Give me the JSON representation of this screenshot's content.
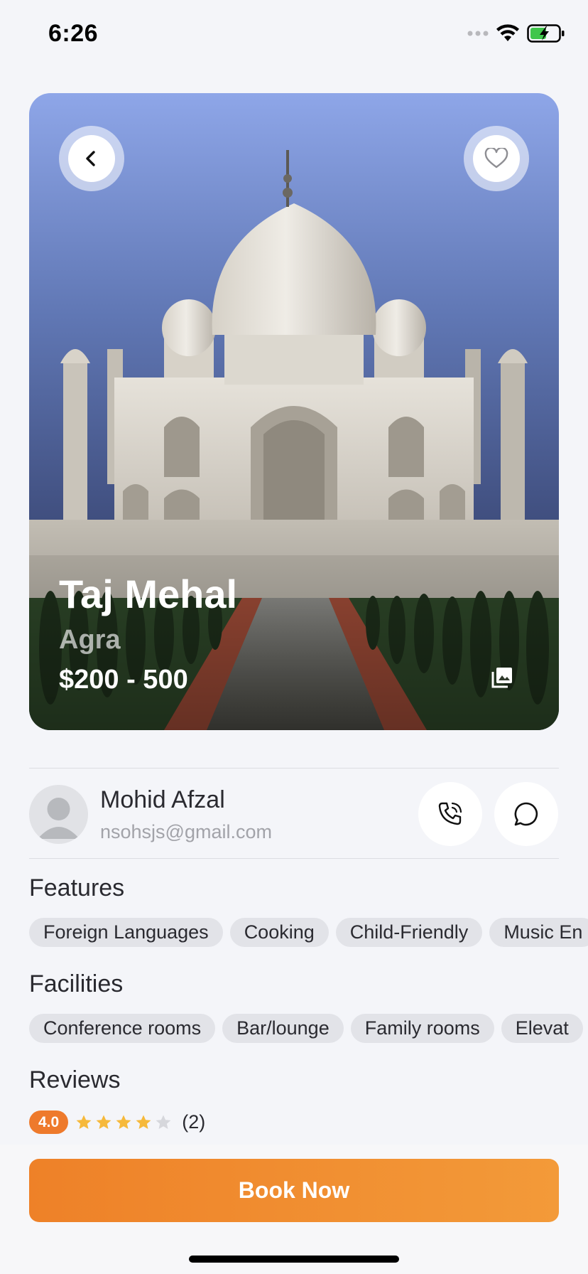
{
  "status_bar": {
    "time": "6:26"
  },
  "place": {
    "name": "Taj Mehal",
    "city": "Agra",
    "price_range": "$200 - 500"
  },
  "host": {
    "name": "Mohid Afzal",
    "email": "nsohsjs@gmail.com"
  },
  "features": {
    "title": "Features",
    "items": [
      "Foreign Languages",
      "Cooking",
      "Child-Friendly",
      "Music En"
    ]
  },
  "facilities": {
    "title": "Facilities",
    "items": [
      "Conference rooms",
      "Bar/lounge",
      "Family rooms",
      "Elevat"
    ]
  },
  "reviews": {
    "title": "Reviews",
    "rating": "4.0",
    "stars_filled": 4,
    "stars_total": 5,
    "count": "(2)"
  },
  "actions": {
    "book_label": "Book Now"
  },
  "colors": {
    "accent": "#EE7A2C",
    "background": "#F4F5F9",
    "star": "#F6B93B",
    "star_empty": "#D6D7DC"
  },
  "icons": {
    "back": "chevron-left-icon",
    "favorite": "heart-icon",
    "gallery": "gallery-icon",
    "call": "phone-call-icon",
    "chat": "chat-bubble-icon",
    "avatar": "user-avatar-icon",
    "star": "star-icon"
  }
}
